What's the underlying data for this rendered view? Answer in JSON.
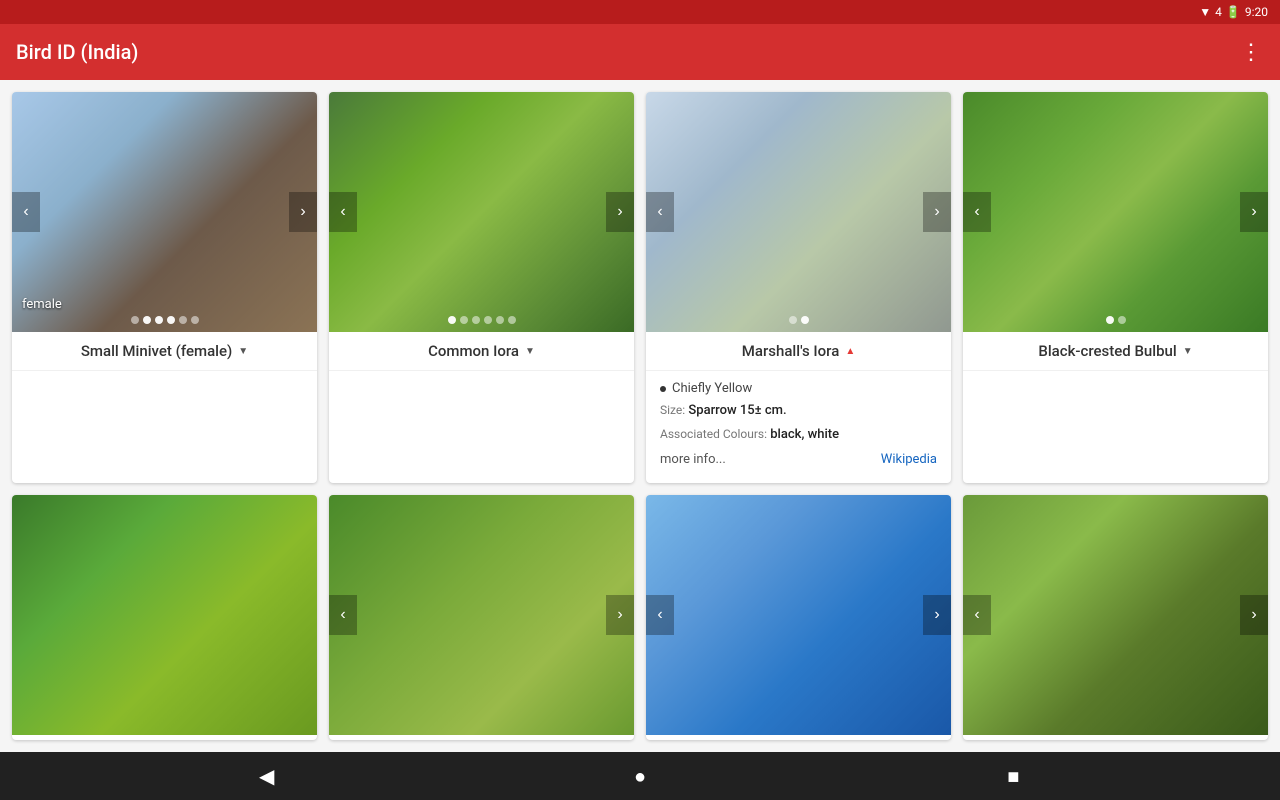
{
  "statusBar": {
    "time": "9:20",
    "batteryIcon": "🔋",
    "wifiIcon": "📶"
  },
  "appBar": {
    "title": "Bird ID (India)",
    "menuIcon": "⋮"
  },
  "cards": [
    {
      "id": "small-minivet",
      "title": "Small Minivet (female)",
      "titleArrow": "▼",
      "arrowDir": "down",
      "bgClass": "bird-small-minivet",
      "overlay": "female",
      "dots": [
        false,
        true,
        true,
        true,
        false,
        false
      ],
      "hasNav": true,
      "expanded": false
    },
    {
      "id": "common-iora",
      "title": "Common Iora",
      "titleArrow": "▼",
      "arrowDir": "down",
      "bgClass": "bird-common-iora",
      "overlay": "",
      "dots": [
        true,
        false,
        false,
        false,
        false,
        false
      ],
      "hasNav": true,
      "expanded": false
    },
    {
      "id": "marshalls-iora",
      "title": "Marshall's Iora",
      "titleArrow": "▲",
      "arrowDir": "up",
      "bgClass": "bird-marshalls-iora",
      "overlay": "",
      "dots": [
        false,
        true
      ],
      "hasNav": true,
      "expanded": true,
      "info": {
        "chiefly": "Chiefly Yellow",
        "sizeLabel": "Size:",
        "sizeValue": "Sparrow 15± cm.",
        "coloursLabel": "Associated Colours:",
        "coloursValue": "black, white",
        "moreInfo": "more info...",
        "wikipedia": "Wikipedia"
      }
    },
    {
      "id": "black-crested-bulbul",
      "title": "Black-crested Bulbul",
      "titleArrow": "▼",
      "arrowDir": "down",
      "bgClass": "bird-black-crested-bulbul",
      "overlay": "",
      "dots": [
        true,
        false
      ],
      "hasNav": true,
      "expanded": false
    },
    {
      "id": "row2-1",
      "title": "",
      "bgClass": "bird-row2-1",
      "hasNav": false,
      "dots": [],
      "expanded": false
    },
    {
      "id": "row2-2",
      "title": "",
      "bgClass": "bird-row2-2",
      "hasNav": true,
      "dots": [],
      "expanded": false
    },
    {
      "id": "row2-3",
      "title": "",
      "bgClass": "bird-row2-3",
      "hasNav": true,
      "dots": [],
      "expanded": false
    },
    {
      "id": "row2-4",
      "title": "",
      "bgClass": "bird-row2-4",
      "hasNav": true,
      "dots": [],
      "expanded": false
    }
  ],
  "bottomNav": {
    "backIcon": "◀",
    "homeIcon": "●",
    "recentIcon": "■"
  }
}
